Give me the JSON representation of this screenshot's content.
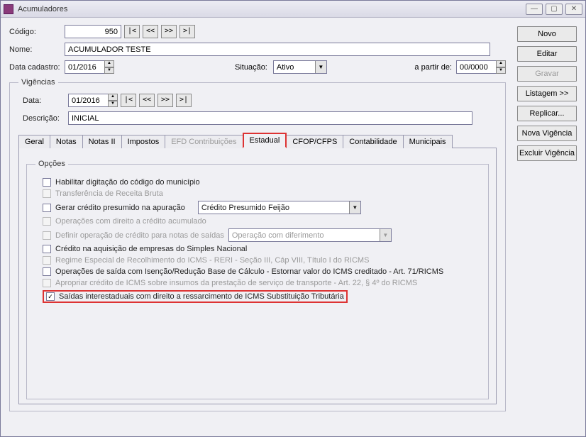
{
  "window": {
    "title": "Acumuladores"
  },
  "sidebar": {
    "novo": "Novo",
    "editar": "Editar",
    "gravar": "Gravar",
    "listagem": "Listagem >>",
    "replicar": "Replicar...",
    "nova_vig": "Nova Vigência",
    "excluir_vig": "Excluir Vigência"
  },
  "form": {
    "codigo_lbl": "Código:",
    "codigo_val": "950",
    "nome_lbl": "Nome:",
    "nome_val": "ACUMULADOR TESTE",
    "datacad_lbl": "Data cadastro:",
    "datacad_val": "01/2016",
    "situacao_lbl": "Situação:",
    "situacao_val": "Ativo",
    "apartir_lbl": "a partir de:",
    "apartir_val": "00/0000",
    "nav": {
      "first": "|<",
      "prev": "<<",
      "next": ">>",
      "last": ">|"
    }
  },
  "vigencias": {
    "legend": "Vigências",
    "data_lbl": "Data:",
    "data_val": "01/2016",
    "desc_lbl": "Descrição:",
    "desc_val": "INICIAL"
  },
  "tabs": {
    "geral": "Geral",
    "notas": "Notas",
    "notas2": "Notas II",
    "impostos": "Impostos",
    "efd": "EFD Contribuições",
    "estadual": "Estadual",
    "cfop": "CFOP/CFPS",
    "contab": "Contabilidade",
    "municipais": "Municipais"
  },
  "opcoes": {
    "legend": "Opções",
    "r1": "Habilitar digitação do código do município",
    "r2": "Transferência de Receita Bruta",
    "r3": "Gerar crédito presumido na apuração",
    "r3_combo": "Crédito Presumido Feijão",
    "r4": "Operações com direito a crédito acumulado",
    "r5": "Definir operação de crédito para notas de saídas",
    "r5_combo": "Operação com diferimento",
    "r6": "Crédito na aquisição de empresas do Simples Nacional",
    "r7": "Regime Especial de Recolhimento do ICMS - RERI - Seção III, Cáp VIII, Título I do RICMS",
    "r8": "Operações de saída com Isenção/Redução Base de Cálculo - Estornar valor do ICMS creditado - Art. 71/RICMS",
    "r9": "Apropriar crédito de ICMS sobre insumos da prestação de serviço de transporte - Art. 22, § 4º do RICMS",
    "r10": "Saídas interestaduais com direito a ressarcimento de ICMS Substituição Tributária"
  }
}
